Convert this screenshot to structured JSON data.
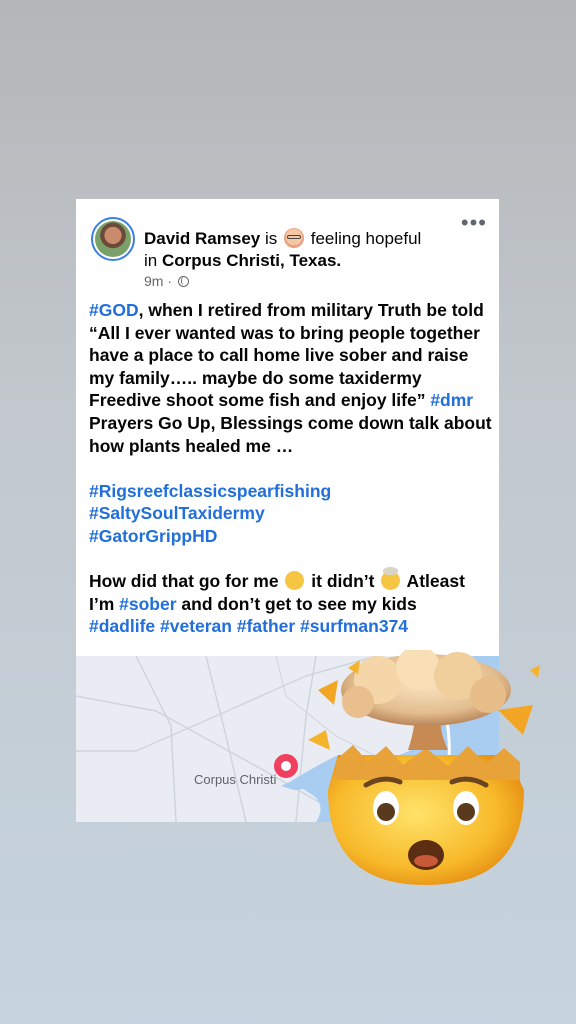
{
  "post": {
    "author": "David Ramsey",
    "is_word": "is",
    "feeling": "feeling hopeful",
    "in_word": "in",
    "location": "Corpus Christi, Texas.",
    "time": "9m ·",
    "more_label": "•••",
    "lines": [
      [
        {
          "t": "#GOD",
          "tag": true
        },
        {
          "t": ", when I retired from military Truth be told"
        }
      ],
      [
        {
          "t": "“All I ever wanted was to bring people together"
        }
      ],
      [
        {
          "t": "have a place to call home live sober and raise"
        }
      ],
      [
        {
          "t": "my family….. maybe do some taxidermy"
        }
      ],
      [
        {
          "t": "Freedive shoot some fish and enjoy life” "
        },
        {
          "t": "#dmr",
          "tag": true
        }
      ],
      [
        {
          "t": "Prayers Go Up, Blessings come down talk about"
        }
      ],
      [
        {
          "t": "how plants healed me …"
        }
      ],
      [],
      [
        {
          "t": "#Rigsreefclassicspearfishing",
          "tag": true
        }
      ],
      [
        {
          "t": "#SaltySoulTaxidermy",
          "tag": true
        }
      ],
      [
        {
          "t": "#GatorGrippHD",
          "tag": true
        }
      ],
      [],
      [
        {
          "t": "How did that go for me "
        },
        {
          "emoji": "rofl"
        },
        {
          "t": "  it didn’t "
        },
        {
          "emoji": "mind"
        },
        {
          "t": " Atleast"
        }
      ],
      [
        {
          "t": "I’m "
        },
        {
          "t": "#sober",
          "tag": true
        },
        {
          "t": " and don’t get to see my kids"
        }
      ],
      [
        {
          "t": "#dadlife #veteran #father #surfman374",
          "tag": true
        }
      ]
    ]
  },
  "map": {
    "city_label": "Corpus Christi"
  },
  "colors": {
    "hashtag": "#216fdb",
    "pin": "#f04060",
    "avatar_ring": "#3b7fe0"
  },
  "sticker": {
    "icon": "exploding-head-emoji"
  }
}
